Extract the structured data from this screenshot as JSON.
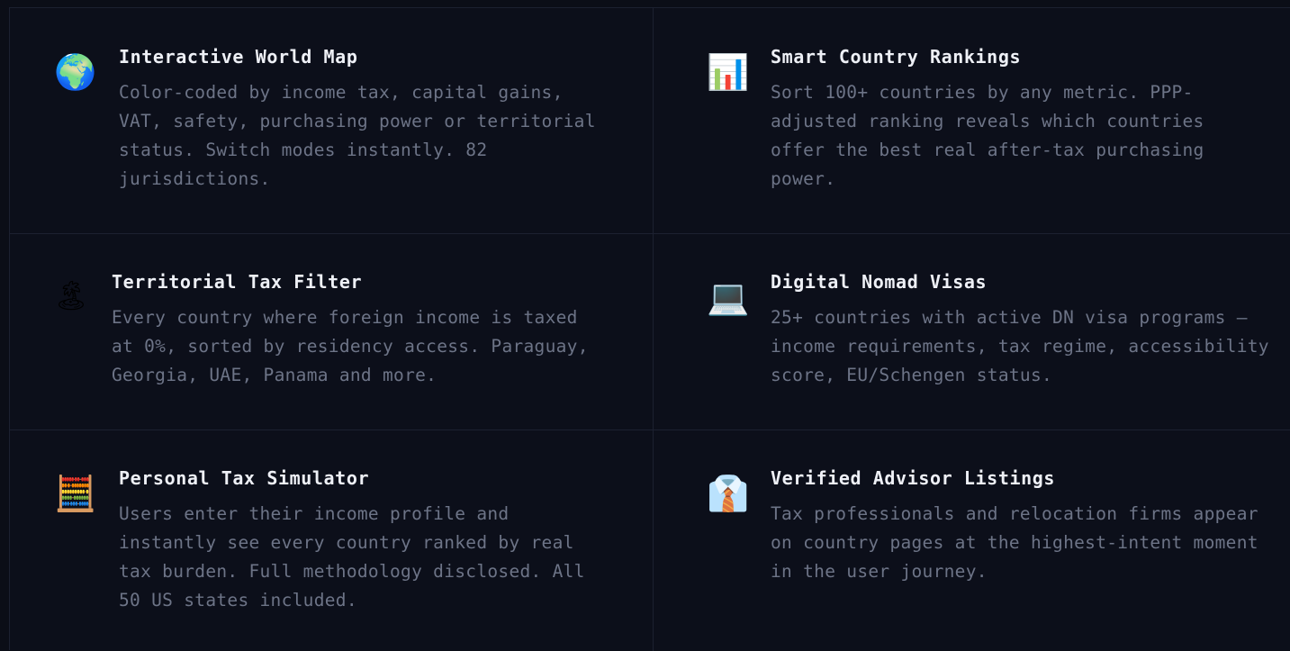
{
  "features": [
    {
      "icon": "🌍",
      "icon_name": "globe-icon",
      "title": "Interactive World Map",
      "description": "Color-coded by income tax, capital gains, VAT, safety, purchasing power or territorial status. Switch modes instantly. 82 jurisdictions."
    },
    {
      "icon": "📊",
      "icon_name": "bar-chart-icon",
      "title": "Smart Country Rankings",
      "description": "Sort 100+ countries by any metric. PPP-adjusted ranking reveals which countries offer the best real after-tax purchasing power."
    },
    {
      "icon": "🏝",
      "icon_name": "island-icon",
      "title": "Territorial Tax Filter",
      "description": "Every country where foreign income is taxed at 0%, sorted by residency access. Paraguay, Georgia, UAE, Panama and more."
    },
    {
      "icon": "💻",
      "icon_name": "laptop-icon",
      "title": "Digital Nomad Visas",
      "description": "25+ countries with active DN visa programs — income requirements, tax regime, accessibility score, EU/Schengen status."
    },
    {
      "icon": "🧮",
      "icon_name": "abacus-icon",
      "title": "Personal Tax Simulator",
      "description": "Users enter their income profile and instantly see every country ranked by real tax burden. Full methodology disclosed. All 50 US states included."
    },
    {
      "icon": "👔",
      "icon_name": "necktie-shirt-icon",
      "title": "Verified Advisor Listings",
      "description": "Tax professionals and relocation firms appear on country pages at the highest-intent moment in the user journey."
    }
  ],
  "colors": {
    "background": "#0c0f1a",
    "border": "#1c2130",
    "title": "#eef0f6",
    "description": "#6d7487"
  }
}
